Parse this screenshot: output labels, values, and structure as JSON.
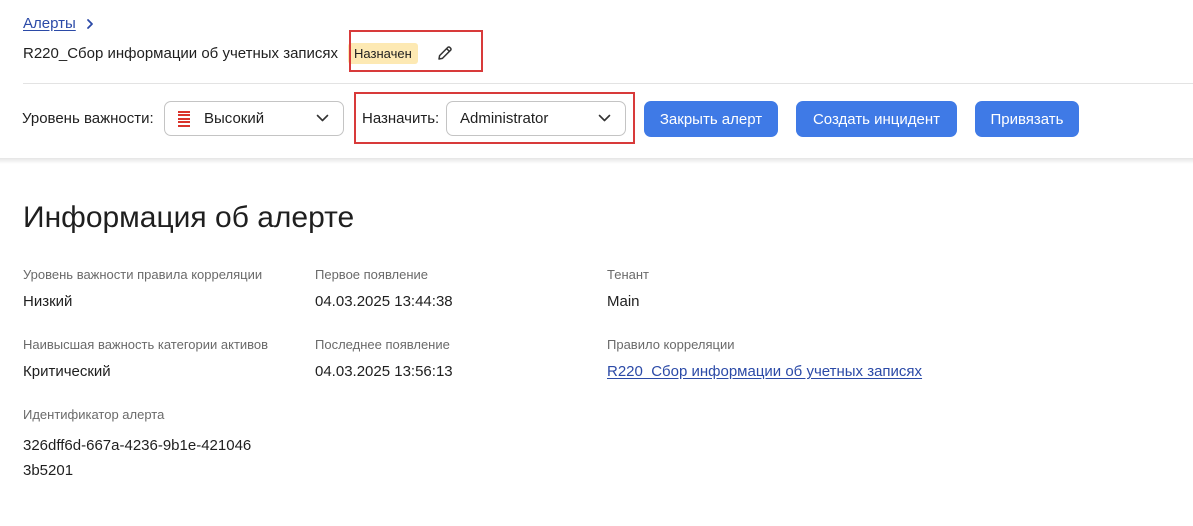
{
  "breadcrumb": {
    "label": "Алерты"
  },
  "header": {
    "title": "R220_Сбор информации об учетных записях",
    "status": "Назначен"
  },
  "toolbar": {
    "severity_label": "Уровень важности:",
    "severity_value": "Высокий",
    "severity_color": "#d9342b",
    "assign_label": "Назначить:",
    "assign_value": "Administrator",
    "close_alert": "Закрыть алерт",
    "create_incident": "Создать инцидент",
    "link": "Привязать",
    "button_color": "#3f7ae6"
  },
  "info": {
    "section_title": "Информация об алерте",
    "rule_severity": {
      "label": "Уровень важности правила корреляции",
      "value": "Низкий"
    },
    "first_seen": {
      "label": "Первое появление",
      "value": "04.03.2025 13:44:38"
    },
    "tenant": {
      "label": "Тенант",
      "value": "Main"
    },
    "asset_severity": {
      "label": "Наивысшая важность категории активов",
      "value": "Критический"
    },
    "last_seen": {
      "label": "Последнее появление",
      "value": "04.03.2025 13:56:13"
    },
    "correlation_rule": {
      "label": "Правило корреляции",
      "value": "R220_Сбор информации об учетных записях"
    },
    "alert_id": {
      "label": "Идентификатор алерта",
      "value": "326dff6d-667a-4236-9b1e-4210463b5201"
    }
  }
}
